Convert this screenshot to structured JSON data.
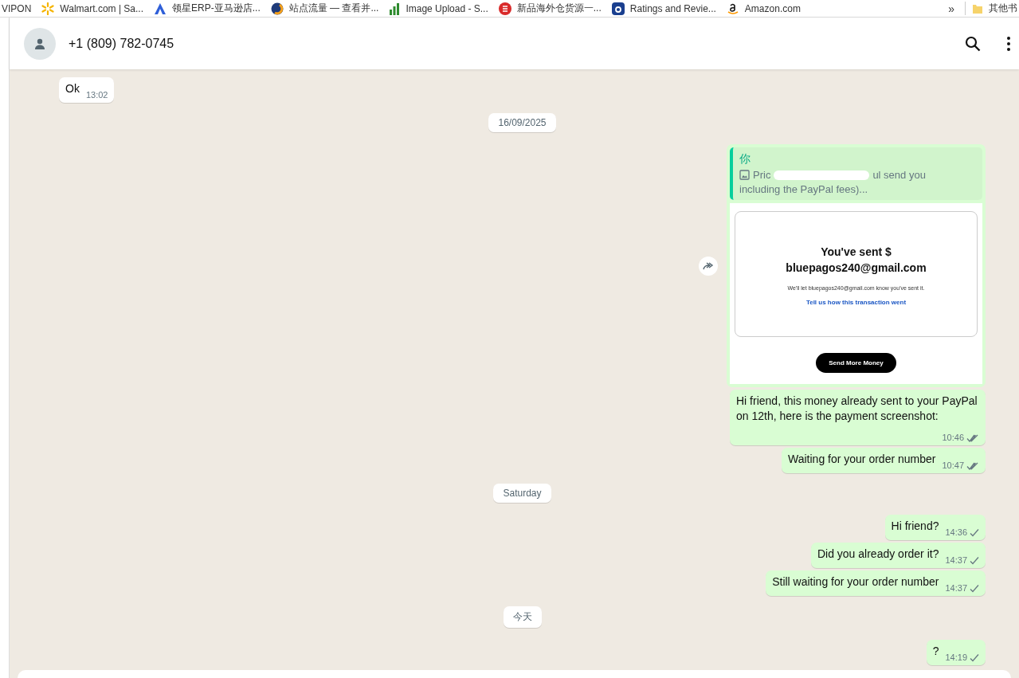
{
  "bookmarks": [
    {
      "label": "VIPON"
    },
    {
      "label": "Walmart.com | Sa..."
    },
    {
      "label": "领星ERP-亚马逊店..."
    },
    {
      "label": "站点流量 — 查看并..."
    },
    {
      "label": "Image Upload - S..."
    },
    {
      "label": "新品海外仓货源一..."
    },
    {
      "label": "Ratings and Revie..."
    },
    {
      "label": "Amazon.com"
    }
  ],
  "bookmarks_more": "»",
  "other_bookmarks": "其他书",
  "contact": {
    "name": "+1 (809) 782-0745"
  },
  "messages": [
    {
      "kind": "incoming",
      "text": "Ok",
      "time": "13:02"
    },
    {
      "kind": "date",
      "text": "16/09/2025"
    },
    {
      "kind": "image",
      "quote_author": "你",
      "quote_parts": [
        "Pric",
        "ul send you"
      ],
      "quote_line2": "including the PayPal fees)...",
      "receipt_title": "You've sent $",
      "receipt_email": "bluepagos240@gmail.com",
      "receipt_note": "We'll let bluepagos240@gmail.com know you've sent it.",
      "receipt_link": "Tell us how this transaction went",
      "receipt_button": "Send More Money"
    },
    {
      "kind": "outgoing",
      "text": "Hi friend, this money already sent to your PayPal on 12th, here is the payment screenshot:",
      "time": "10:46",
      "double_check": true
    },
    {
      "kind": "outgoing",
      "text": "Waiting for your order number",
      "time": "10:47",
      "double_check": true
    },
    {
      "kind": "date",
      "text": "Saturday"
    },
    {
      "kind": "outgoing",
      "text": "Hi friend?",
      "time": "14:36",
      "double_check": false
    },
    {
      "kind": "outgoing",
      "text": "Did you already order it?",
      "time": "14:37",
      "double_check": false
    },
    {
      "kind": "outgoing",
      "text": "Still waiting for your order number",
      "time": "14:37",
      "double_check": false
    },
    {
      "kind": "date",
      "text": "今天"
    },
    {
      "kind": "outgoing",
      "text": "?",
      "time": "14:19",
      "double_check": false
    }
  ]
}
